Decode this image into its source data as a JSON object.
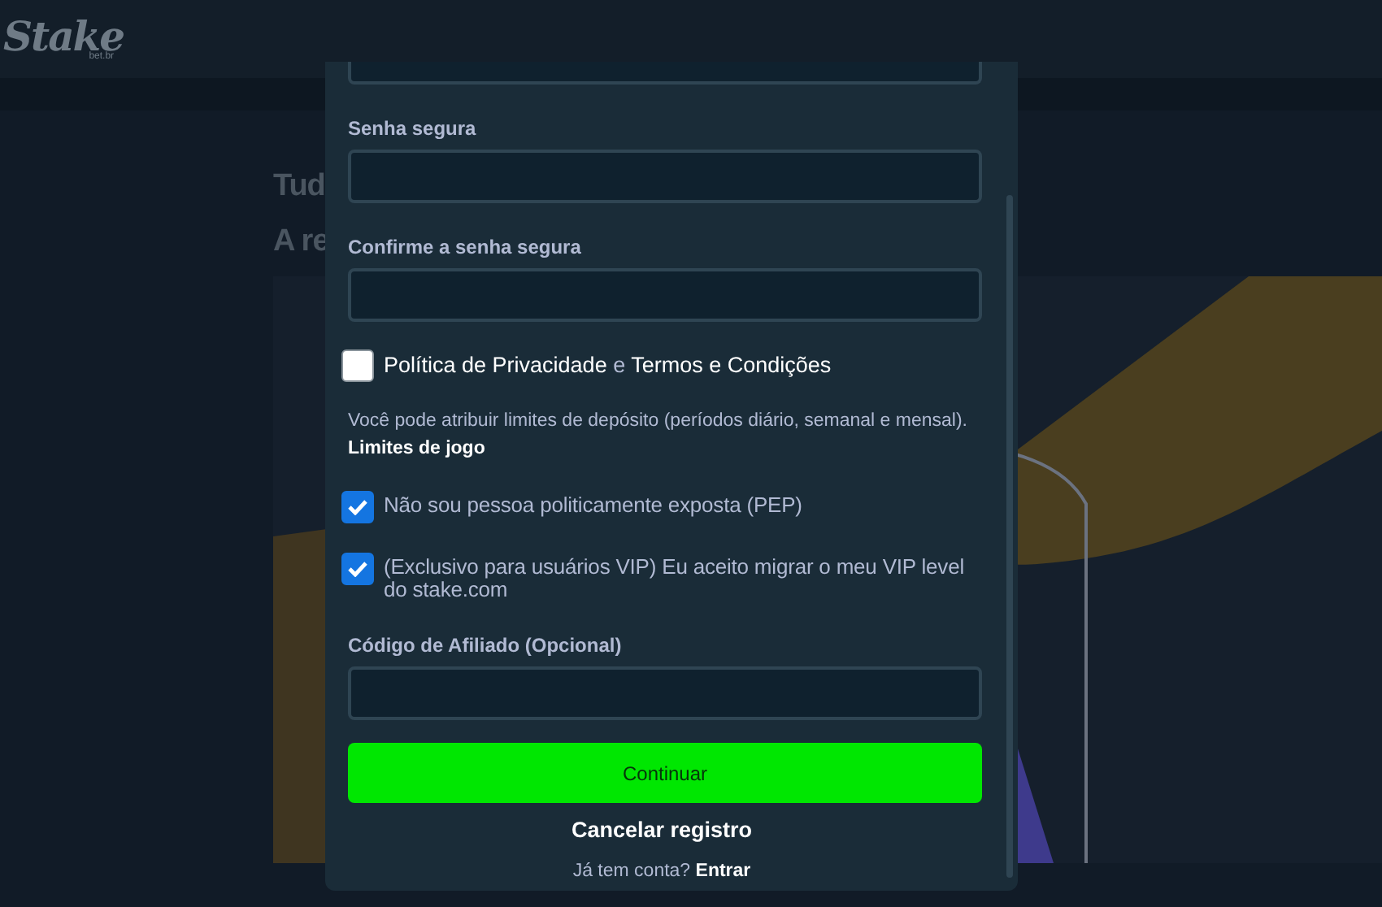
{
  "header": {
    "logo": "Stake",
    "logo_sub": "bet.br"
  },
  "background": {
    "lines": [
      "Tud",
      "A re"
    ]
  },
  "modal": {
    "fields": [
      {
        "label": "Senha segura"
      },
      {
        "label": "Confirme a senha segura"
      }
    ],
    "terms": {
      "checked": false,
      "link_1": "Política de Privacidade",
      "joiner": "e",
      "link_2": "Termos e Condições"
    },
    "limits_note": "Você pode atribuir limites de depósito (períodos diário, semanal e mensal).",
    "limits_link": "Limites de jogo",
    "checks": [
      {
        "label": "Não sou pessoa politicamente exposta (PEP)",
        "checked": true
      },
      {
        "label": "(Exclusivo para usuários VIP) Eu aceito migrar o meu VIP level do stake.com",
        "checked": true
      }
    ],
    "affiliate": {
      "label": "Código de Afiliado (Opcional)"
    },
    "submit": "Continuar",
    "cancel": "Cancelar registro",
    "footer_text": "Já tem conta?",
    "footer_link": "Entrar"
  }
}
